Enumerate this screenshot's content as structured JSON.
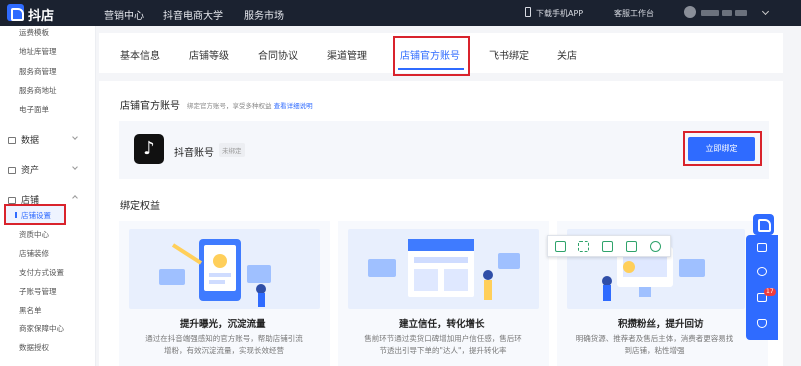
{
  "topbar": {
    "logo_text": "抖店",
    "nav": [
      "营销中心",
      "抖音电商大学",
      "服务市场"
    ],
    "download_app": "下载手机APP",
    "service_desk": "客服工作台"
  },
  "sidebar": {
    "sub_items_top": [
      "运费模板",
      "地址库管理",
      "服务商管理",
      "服务商地址",
      "电子面单"
    ],
    "groups": {
      "data": "数据",
      "assets": "资产",
      "store": "店铺"
    },
    "store_items": [
      "店铺设置",
      "资质中心",
      "店铺装修",
      "支付方式设置",
      "子账号管理",
      "黑名单",
      "商家保障中心",
      "数据授权"
    ]
  },
  "tabs": [
    "基本信息",
    "店铺等级",
    "合同协议",
    "渠道管理",
    "店铺官方账号",
    "飞书绑定",
    "关店"
  ],
  "official": {
    "title": "店铺官方账号",
    "hint": "绑定官方账号，享受多种权益",
    "hint_link": "查看详细说明",
    "account_label": "抖音账号",
    "badge": "未绑定",
    "bind_button": "立即绑定"
  },
  "benefits": {
    "title": "绑定权益",
    "cards": [
      {
        "title": "提升曝光，沉淀流量",
        "desc": [
          "通过在抖音端强感知的官方账号，帮助店铺引流",
          "增粉，有效沉淀流量，实现长效经营"
        ]
      },
      {
        "title": "建立信任，转化增长",
        "desc": [
          "售前环节通过卖货口碑增加用户信任感，售后环",
          "节透出引导下单的\"达人\"，提升转化率"
        ]
      },
      {
        "title": "积攒粉丝，提升回访",
        "desc": [
          "明确货源、推荐者及售后主体，消费者更容易找",
          "到店铺，粘性增强"
        ]
      }
    ]
  },
  "rail": {
    "badge_count": "17"
  },
  "colors": {
    "accent": "#2f6bff",
    "highlight": "#d9232c",
    "topbar": "#1b2230"
  }
}
